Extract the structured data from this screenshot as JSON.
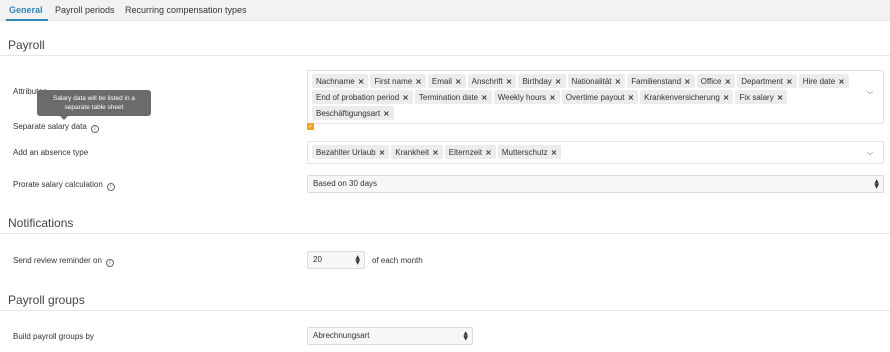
{
  "tabs": [
    {
      "label": "General"
    },
    {
      "label": "Payroll periods"
    },
    {
      "label": "Recurring compensation types"
    }
  ],
  "payroll": {
    "section_title": "Payroll",
    "attributes": {
      "label": "Attributes",
      "tags": [
        "Nachname",
        "First name",
        "Email",
        "Anschrift",
        "Birthday",
        "Nationalität",
        "Familienstand",
        "Office",
        "Department",
        "Hire date",
        "End of probation period",
        "Termination date",
        "Weekly hours",
        "Overtime payout",
        "Krankenversicherung",
        "Fix salary",
        "Beschäftigungsart"
      ]
    },
    "tooltip": {
      "line1": "Salary data will be listed in a",
      "line2": "separate table sheet"
    },
    "separate_salary": {
      "label": "Separate salary data",
      "checked": true
    },
    "absence": {
      "label": "Add an absence type",
      "tags": [
        "Bezahlter Urlaub",
        "Krankheit",
        "Elternzeit",
        "Mutterschutz"
      ]
    },
    "prorate": {
      "label": "Prorate salary calculation",
      "value": "Based on 30 days"
    }
  },
  "notifications": {
    "section_title": "Notifications",
    "reminder": {
      "label": "Send review reminder on",
      "value": "20",
      "suffix": "of each month"
    }
  },
  "payroll_groups": {
    "section_title": "Payroll groups",
    "build": {
      "label": "Build payroll groups by",
      "value": "Abrechnungsart"
    }
  },
  "colors": {
    "accent": "#2d87b8",
    "checkbox": "#f0a020"
  },
  "icons": {
    "info": "info-icon",
    "remove": "close-icon",
    "dropdown": "chevron-down-icon",
    "updown": "sort-arrows-icon"
  }
}
